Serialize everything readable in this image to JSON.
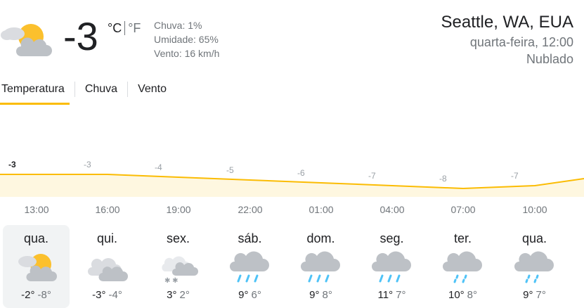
{
  "current": {
    "temperature": "-3",
    "unit_c": "°C",
    "unit_f": "°F",
    "precip": "Chuva: 1%",
    "humidity": "Umidade: 65%",
    "wind": "Vento: 16 km/h",
    "icon": "partly-cloudy-icon"
  },
  "location": {
    "city": "Seattle, WA, EUA",
    "datetime": "quarta-feira, 12:00",
    "condition": "Nublado"
  },
  "tabs": [
    {
      "label": "Temperatura",
      "active": true
    },
    {
      "label": "Chuva",
      "active": false
    },
    {
      "label": "Vento",
      "active": false
    }
  ],
  "colors": {
    "accent": "#fbbc04",
    "fill": "#fef7e0",
    "rain": "#4fc3f7"
  },
  "chart_data": {
    "type": "area",
    "x": [
      "13:00",
      "16:00",
      "19:00",
      "22:00",
      "01:00",
      "04:00",
      "07:00",
      "10:00"
    ],
    "values": [
      -3,
      -3,
      -4,
      -5,
      -6,
      -7,
      -8,
      -7
    ],
    "labels": [
      "-3",
      "-3",
      "-4",
      "-5",
      "-6",
      "-7",
      "-8",
      "-7"
    ]
  },
  "forecast": [
    {
      "day": "qua.",
      "icon": "partly-cloudy-icon",
      "hi": "-2°",
      "lo": "-8°",
      "selected": true
    },
    {
      "day": "qui.",
      "icon": "cloudy-icon",
      "hi": "-3°",
      "lo": "-4°",
      "selected": false
    },
    {
      "day": "sex.",
      "icon": "snow-cloud-icon",
      "hi": "3°",
      "lo": "2°",
      "selected": false
    },
    {
      "day": "sáb.",
      "icon": "rain-icon",
      "hi": "9°",
      "lo": "6°",
      "selected": false
    },
    {
      "day": "dom.",
      "icon": "rain-icon",
      "hi": "9°",
      "lo": "8°",
      "selected": false
    },
    {
      "day": "seg.",
      "icon": "rain-icon",
      "hi": "11°",
      "lo": "7°",
      "selected": false
    },
    {
      "day": "ter.",
      "icon": "light-rain-icon",
      "hi": "10°",
      "lo": "8°",
      "selected": false
    },
    {
      "day": "qua.",
      "icon": "light-rain-icon",
      "hi": "9°",
      "lo": "7°",
      "selected": false
    }
  ]
}
